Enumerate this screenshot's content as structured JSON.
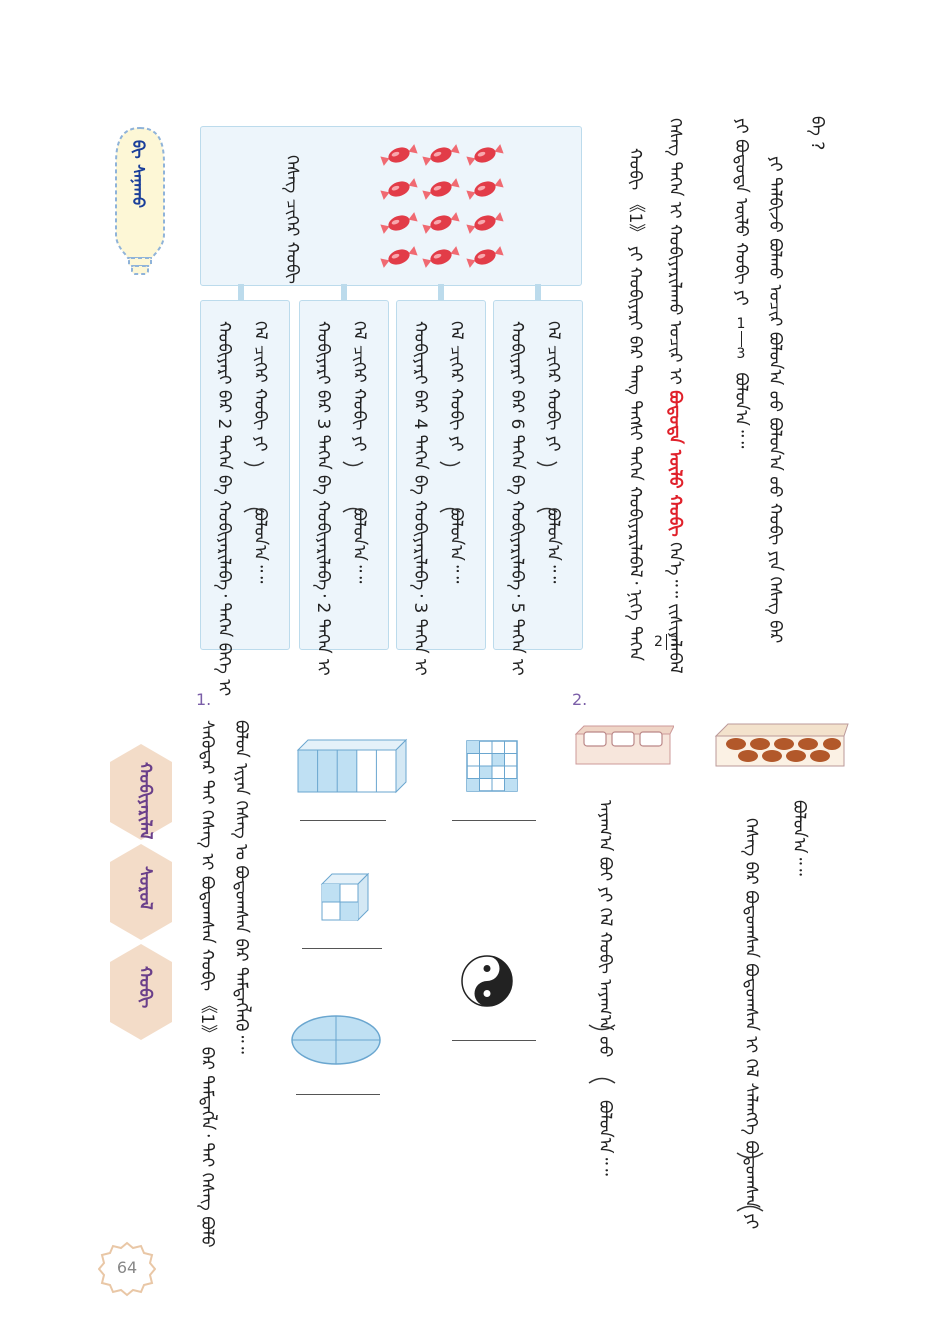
{
  "question_mark": "ᠪᠡ ?",
  "text_lines": [
    "ᠶᠢ ᠲᠠᠯᠪᠢᠵᠤ ᠪᠣᠯᠬᠤ ᠤᠴᠢᠷ ᠪᠣᠯᠤᠨ᠎ᠠ ᠦᠦ ᠪᠣᠯᠤᠨ᠎ᠠ ᠦᠦ ᠬᠤᠪᠢ ᠶᠢᠨ ᠬᠡᠰᠡᠭ ᠪᠡᠷ",
    "ᠶᠢ ᠪᠤᠳᠤᠳᠠ ᠦᠯᠦ ᠬᠤᠪᠢ ᠶᠢ",
    "ᠪᠣᠯᠤᠨ᠎ᠠ᠃᠃",
    "ᠬᠡᠰᠡᠭ ᠲᠡᠭᠡᠨ ᠢ ᠬᠤᠪᠢᠶᠠᠷᠢᠯᠠᠬᠤ ᠤᠴᠢᠷ ᠢ",
    "ᠪᠤᠳᠤᠳᠠ ᠦᠯᠦ ᠬᠤᠪᠢ",
    "ᠭᠡᠨ᠎ᠡ᠃᠃ ᠵᠢᠱᠢᠶᠡᠯᠡᠪᠡᠯ",
    "ᠬᠤᠪᠢ 《1》 ᠶᠢ ᠬᠤᠪᠢᠶᠠᠷᠢ ᠪᠡᠷ ᠲᠡᠩ ᠲᠡᠭᠰᠢ ᠲᠡᠭᠡᠨ ᠬᠤᠪᠢᠶᠠᠷᠢᠯᠠᠪᠠᠯ᠂ ᠨᠢᠭᠡ ᠲᠡᠭᠡᠨ"
  ],
  "fractions": {
    "one_third": {
      "num": "1",
      "den": "3"
    },
    "two_thirds": {
      "num": "2",
      "den": "3"
    }
  },
  "candy_box_label": "ᠬᠡᠰᠡᠭ ᠴᠢᠬᠡᠷ ᠬᠤᠪᠢ",
  "sub_boxes": [
    {
      "line1": "ᠬᠡᠯ ᠴᠢᠬᠡᠷ ᠬᠤᠪᠢ ᠶᠢ",
      "line1_end": "ᠪᠣᠯᠤᠨ᠎ᠠ᠃᠃",
      "line2": "ᠬᠤᠪᠢᠶᠠᠷᠢ ᠪᠡᠷ 6 ᠲᠡᠭᠡᠨ ᠪᠡ ᠬᠤᠪᠢᠶᠠᠷᠢᠯᠠᠪᠠ᠂ 5 ᠲᠡᠭᠡᠨ ᠢ"
    },
    {
      "line1": "ᠬᠡᠯ ᠴᠢᠬᠡᠷ ᠬᠤᠪᠢ ᠶᠢ",
      "line1_end": "ᠪᠣᠯᠤᠨ᠎ᠠ᠃᠃",
      "line2": "ᠬᠤᠪᠢᠶᠠᠷᠢ ᠪᠡᠷ 4 ᠲᠡᠭᠡᠨ ᠪᠡ ᠬᠤᠪᠢᠶᠠᠷᠢᠯᠠᠪᠠ᠂ 3 ᠲᠡᠭᠡᠨ ᠢ"
    },
    {
      "line1": "ᠬᠡᠯ ᠴᠢᠬᠡᠷ ᠬᠤᠪᠢ ᠶᠢ",
      "line1_end": "ᠪᠣᠯᠤᠨ᠎ᠠ᠃᠃",
      "line2": "ᠬᠤᠪᠢᠶᠠᠷᠢ ᠪᠡᠷ 3 ᠲᠡᠭᠡᠨ ᠪᠡ ᠬᠤᠪᠢᠶᠠᠷᠢᠯᠠᠪᠠ᠂ 2 ᠲᠡᠭᠡᠨ ᠢ"
    },
    {
      "line1": "ᠬᠡᠯ ᠴᠢᠬᠡᠷ ᠬᠤᠪᠢ ᠶᠢ",
      "line1_end": "ᠪᠣᠯᠤᠨ᠎ᠠ᠃᠃",
      "line2": "ᠬᠤᠪᠢᠶᠠᠷᠢ ᠪᠡᠷ 2 ᠲᠡᠭᠡᠨ ᠪᠡ ᠬᠤᠪᠢᠶᠠᠷᠢᠯᠠᠪᠠ᠂ ᠲᠡᠭᠡᠨ ᠪᠡᠭᠡ ᠢ"
    }
  ],
  "bulb_label": "ᠪᠢ ᠰᠠᠨᠠᠬᠤ",
  "exercise_2": {
    "number": "2.",
    "eggs_line": "ᠬᠡᠰᠡᠭ ᠪᠡᠷ ᠪᠤᠳᠤᠭᠰᠠᠨ ᠪᠤᠳᠤᠭᠰᠠᠨ ᠢ ᠬᠡᠯ ᠰᠡᠯᠡᠩᠭᠡ ᠪᠤᠳᠤᠭᠰᠠᠨ ᠶᠢ",
    "eggs_end": "ᠪᠣᠯᠤᠨ᠎ᠠ᠃᠃",
    "cups_line": "ᠠᠶᠠᠭ᠎ᠠ ᠪᠤᠢ ᠶᠢ ᠬᠡᠯ ᠬᠤᠪᠢ ᠠᠶᠠᠭ᠎ᠠ ᠦᠦ",
    "cups_end": "ᠪᠣᠯᠤᠨ᠎ᠠ᠃᠃"
  },
  "exercise_1": {
    "number": "1.",
    "line_a": "ᠰᠡᠭᠦᠳᠡᠷ ᠲᠡᠢ ᠬᠡᠰᠡᠭ ᠢ ᠪᠤᠳᠤᠭᠰᠠᠨ ᠬᠤᠪᠢ 《1》 ᠪᠡᠷ ᠲᠡᠮᠳᠡᠭᠯᠡ᠂ ᠲᠡᠢ ᠬᠡᠰᠡᠭ ᠪᠣᠯᠤ",
    "line_b": "ᠪᠣᠯᠤᠨ ᠢᠶᠠᠨ ᠬᠡᠰᠡᠭ ᠤ ᠪᠤᠳᠤᠭᠰᠠᠨ ᠪᠡᠷ ᠲᠡᠮᠳᠡᠭᠯᠡᠬᠦ᠃᠃"
  },
  "tabs": [
    "ᠬᠤᠪᠢᠶᠠᠷᠢᠯᠠᠯ",
    "ᠰᠤᠷᠤᠯ",
    "ᠬᠤᠪᠢ"
  ],
  "page_number": "64",
  "colors": {
    "accent_purple": "#7b5ea8",
    "red": "#e0202a",
    "box_fill": "#edf5fb",
    "shape_blue": "#bfe0f3",
    "hex": "#f3dcc8"
  }
}
